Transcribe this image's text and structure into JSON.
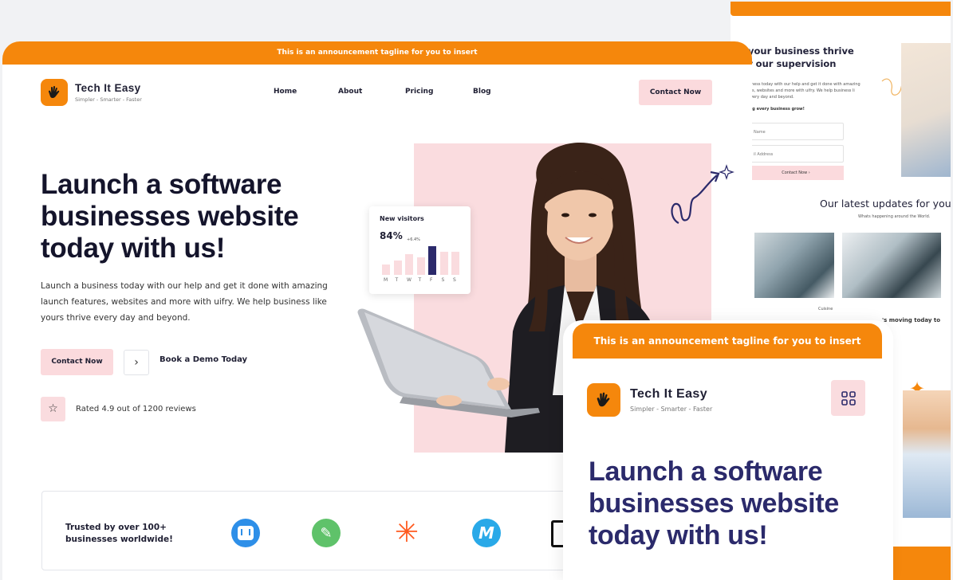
{
  "announcement": "This is an announcement tagline for you to insert",
  "brand": {
    "name": "Tech It Easy",
    "tagline": "Simpler - Smarter - Faster"
  },
  "nav": {
    "items": [
      {
        "label": "Home"
      },
      {
        "label": "About"
      },
      {
        "label": "Pricing"
      },
      {
        "label": "Blog"
      }
    ],
    "cta_label": "Contact Now"
  },
  "hero": {
    "title_lines": [
      "Launch a software",
      "businesses website",
      "today with us!"
    ],
    "description_lines": [
      "Launch a business today with our help and get it done with amazing",
      "launch features, websites and more with uifry. We help business like",
      "yours thrive every day and beyond."
    ],
    "primary_cta": "Contact Now",
    "secondary_cta": "Book a Demo Today",
    "rating_text": "Rated 4.9 out of 1200 reviews"
  },
  "visitor_card": {
    "title": "New visitors",
    "value": "84%",
    "change": "+6.4%",
    "days": [
      "M",
      "T",
      "W",
      "T",
      "F",
      "S",
      "S"
    ],
    "bar_levels": [
      0.35,
      0.5,
      0.72,
      0.6,
      1.0,
      0.8,
      0.8
    ],
    "highlight_index": 4
  },
  "trusted": {
    "line1": "Trusted by over 100+",
    "line2": "businesses worldwide!",
    "logos": [
      "intercom-logo",
      "shopify-logo",
      "zapier-logo",
      "mailchimp-logo",
      "notion-logo"
    ]
  },
  "back_page": {
    "headline_lines": [
      "your business thrive",
      "r our supervision"
    ],
    "body_lines": [
      "siness today with our help and get it done with amazing",
      "res, websites and more with uifry. We help business li",
      "every day and beyond."
    ],
    "subtitle": "ing every business grow!",
    "field_name": "Name",
    "field_email": "il Address",
    "cta": "Contact Now",
    "section_title": "Our latest updates for you he",
    "section_sub": "Whats happening around the World.",
    "caption": "Cuisine",
    "moving": "'s moving today to"
  },
  "colors": {
    "accent": "#f5870c",
    "pink": "#fadcdf",
    "navy": "#14142b",
    "purple": "#2b2a6b"
  }
}
